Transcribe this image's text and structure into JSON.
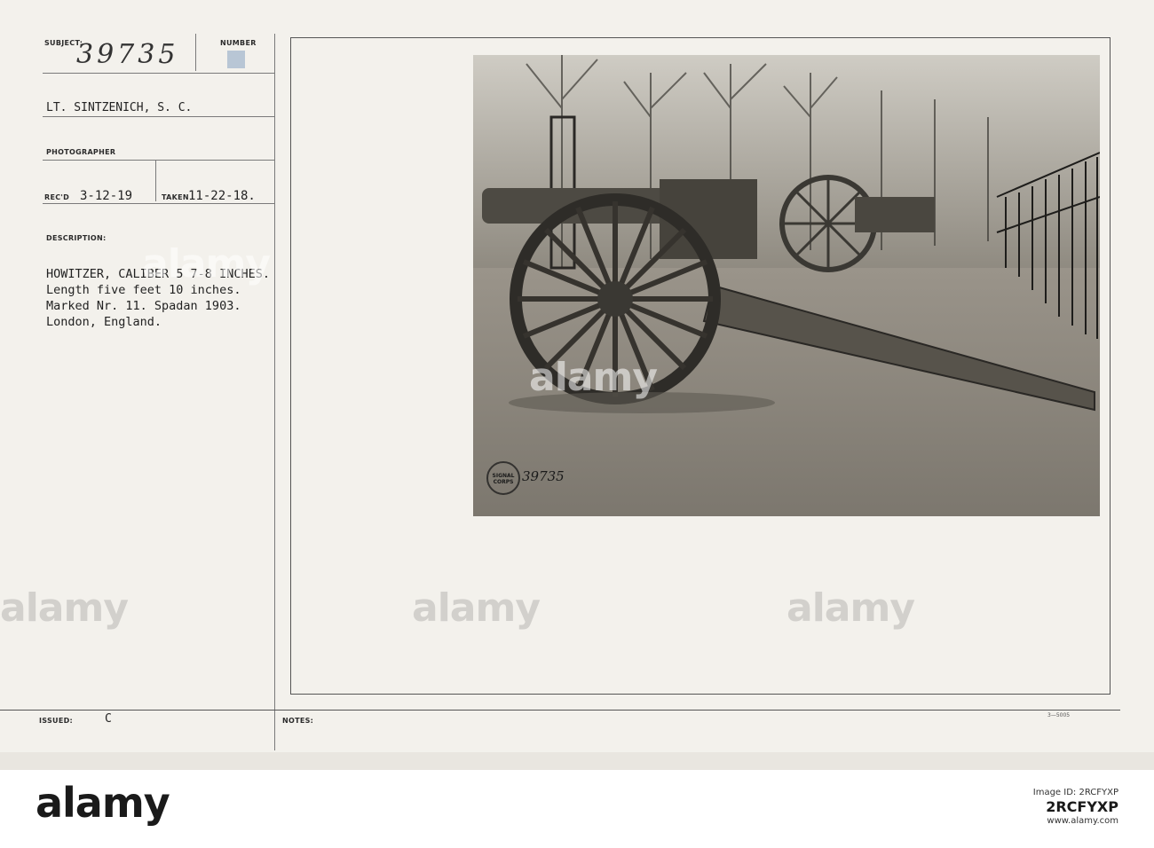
{
  "card": {
    "subject_label": "SUBJECT:",
    "subject_number": "39735",
    "number_label": "NUMBER",
    "photographer_name": "LT. SINTZENICH, S. C.",
    "photographer_label": "PHOTOGRAPHER",
    "recd_label": "REC'D",
    "recd_date": "3-12-19",
    "taken_label": "TAKEN",
    "taken_date": "11-22-18.",
    "description_label": "DESCRIPTION:",
    "description_lines": [
      "HOWITZER, CALIBER 5 7-8 INCHES.",
      "Length five feet 10 inches.",
      "Marked Nr. 11. Spadan 1903.",
      "London, England."
    ],
    "issued_label": "ISSUED:",
    "issued_value": "C",
    "notes_label": "NOTES:",
    "form_number": "3—5005"
  },
  "photo": {
    "stamp_text": "SIGNAL CORPS",
    "stamp_number": "39735"
  },
  "alamy": {
    "logo": "alamy",
    "watermark": "alamy",
    "image_id_label": "Image ID: 2RCFYXP",
    "site": "www.alamy.com",
    "code": "2RCFYXP"
  },
  "colors": {
    "card_bg": "#f3f1ec",
    "photo_sepia": "#6f6a60",
    "number_tab": "#a9bcd0"
  }
}
